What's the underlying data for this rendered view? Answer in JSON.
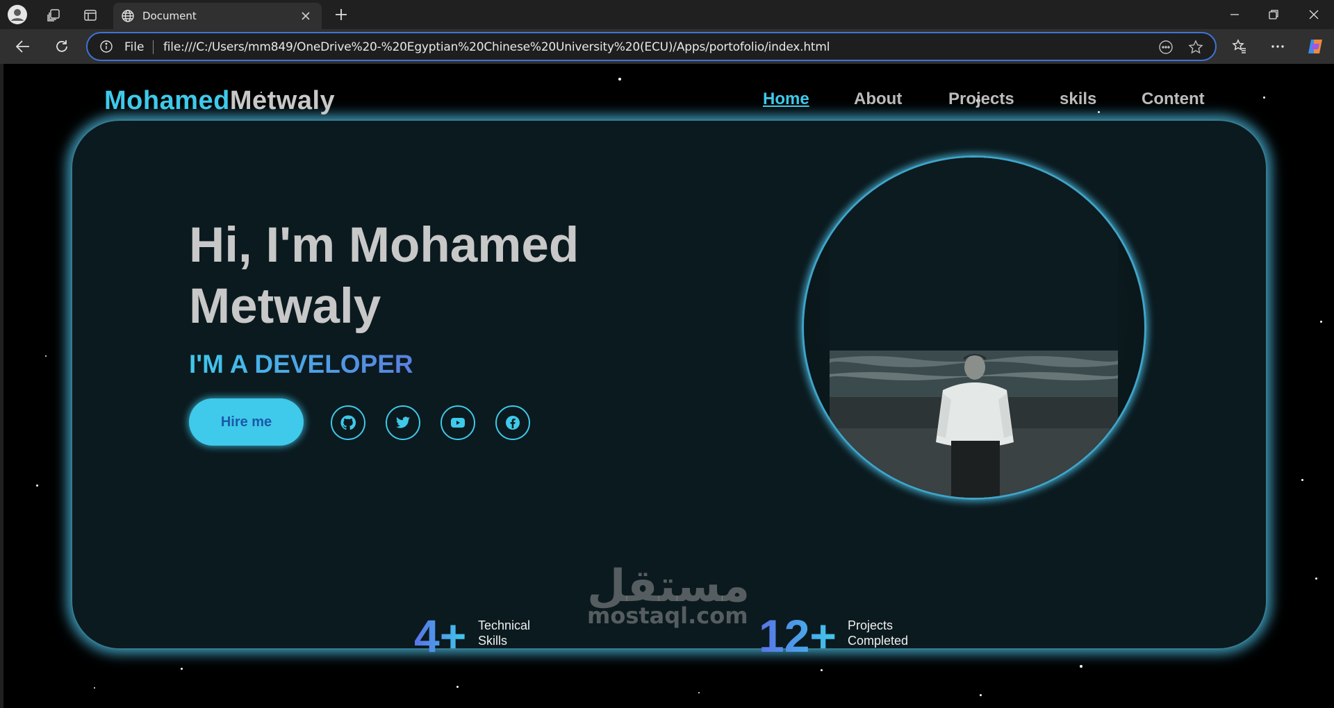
{
  "browser": {
    "tab_title": "Document",
    "url_scheme_label": "File",
    "url": "file:///C:/Users/mm849/OneDrive%20-%20Egyptian%20Chinese%20University%20(ECU)/Apps/portofolio/index.html"
  },
  "site": {
    "logo_first": "Mohamed",
    "logo_last": "Metwaly",
    "nav": [
      "Home",
      "About",
      "Projects",
      "skils",
      "Content"
    ],
    "active_nav": "Home",
    "hero_line1": "Hi, I'm Mohamed",
    "hero_line2": "Metwaly",
    "subtitle": "I'M A DEVELOPER",
    "hire_label": "Hire me",
    "socials": [
      "github-icon",
      "twitter-icon",
      "youtube-icon",
      "facebook-icon"
    ],
    "stats": [
      {
        "number": "4+",
        "label_line1": "Technical",
        "label_line2": "Skills"
      },
      {
        "number": "12+",
        "label_line1": "Projects",
        "label_line2": "Completed"
      }
    ],
    "colors": {
      "accent": "#3fc9ea",
      "card": "#0b1a1f",
      "text": "#c8c8c8"
    }
  },
  "watermark": {
    "arabic": "مستقل",
    "latin": "mostaql.com"
  }
}
